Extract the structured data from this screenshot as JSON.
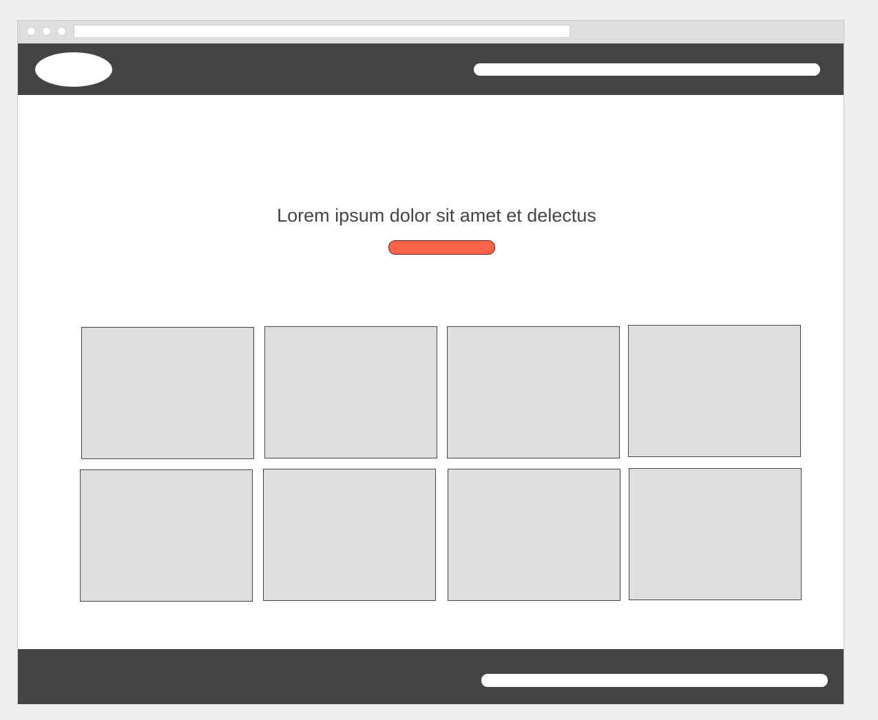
{
  "hero": {
    "title": "Lorem ipsum dolor sit amet et delectus"
  },
  "colors": {
    "header_background": "#444444",
    "footer_background": "#444444",
    "cta_accent": "#ff6347",
    "tile_fill": "#dedede",
    "page_background": "#eeeeee"
  },
  "gallery": {
    "rows": 2,
    "columns": 4
  }
}
